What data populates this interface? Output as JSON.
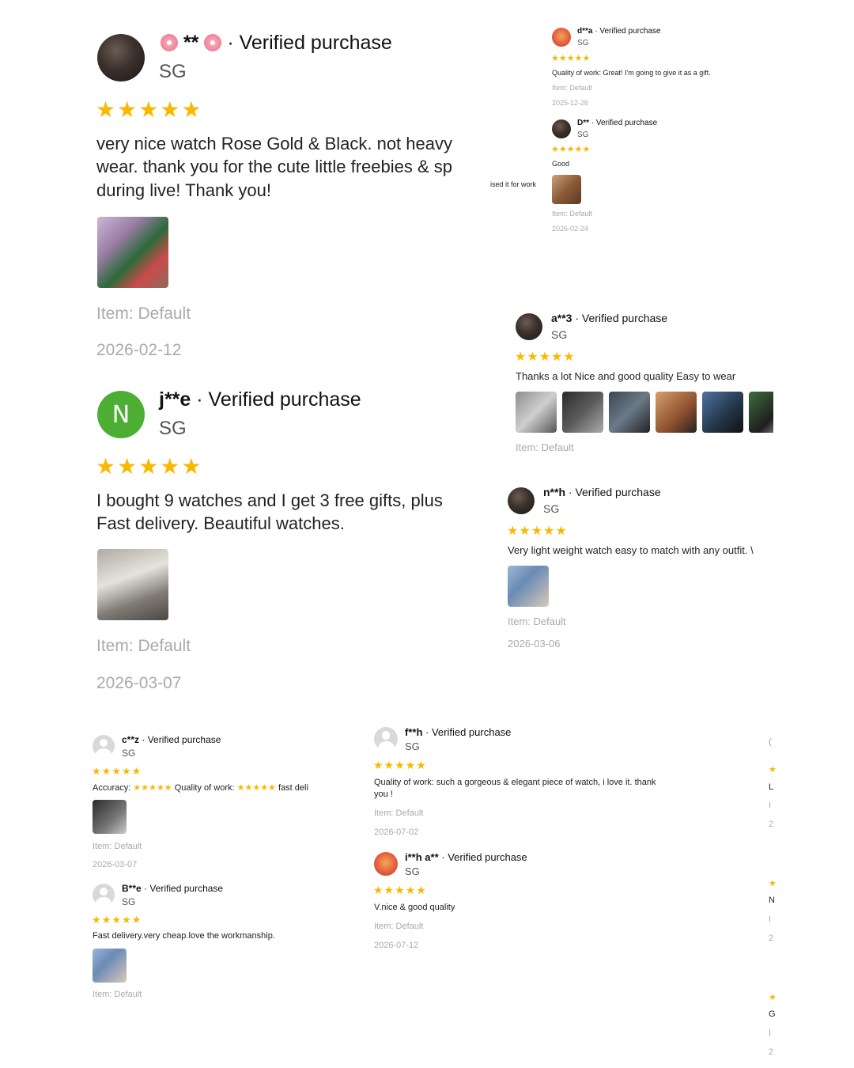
{
  "colors": {
    "star": "#f9b800",
    "meta": "#aaaaaa",
    "green_avatar": "#4caf33"
  },
  "reviews": {
    "r1": {
      "name": "**",
      "sep": "· Verified purchase",
      "country": "SG",
      "stars": "★★★★★",
      "text1": "very nice watch Rose Gold & Black. not heavy",
      "text2": "wear. thank you for the cute little freebies & sp",
      "text3": "during live! Thank you!",
      "item": "Item: Default",
      "date": "2026-02-12"
    },
    "r2": {
      "name": "j**e",
      "sep": "· Verified purchase",
      "country": "SG",
      "avatar_letter": "N",
      "stars": "★★★★★",
      "text1": "I bought 9 watches and I get 3 free gifts, plus",
      "text2": "Fast delivery. Beautiful watches.",
      "item": "Item: Default",
      "date": "2026-03-07"
    },
    "r3": {
      "name": "d**a",
      "sep": "· Verified purchase",
      "country": "SG",
      "stars": "★★★★★",
      "text": "Quality of work: Great! I'm going to give it as a gift.",
      "item": "Item: Default",
      "date": "2025-12-26"
    },
    "r4": {
      "name": "D**",
      "sep": "· Verified purchase",
      "country": "SG",
      "stars": "★★★★★",
      "text": "Good",
      "item": "Item: Default",
      "date": "2026-02-24",
      "side_fragment": "ised it for work"
    },
    "r5": {
      "name": "a**3",
      "sep": "· Verified purchase",
      "country": "SG",
      "stars": "★★★★★",
      "text": "Thanks a lot Nice and good quality Easy to wear",
      "item": "Item: Default"
    },
    "r6": {
      "name": "n**h",
      "sep": "· Verified purchase",
      "country": "SG",
      "stars": "★★★★★",
      "text": "Very light weight watch easy to match with any outfit. \\",
      "item": "Item: Default",
      "date": "2026-03-06"
    },
    "r7": {
      "name": "c**z",
      "sep": "· Verified purchase",
      "country": "SG",
      "stars": "★★★★★",
      "accuracy_label": "Accuracy:",
      "quality_label": "Quality of work:",
      "text_tail": "fast deli",
      "mini_stars": "★★★★★",
      "item": "Item: Default",
      "date": "2026-03-07"
    },
    "r8": {
      "name": "B**e",
      "sep": "· Verified purchase",
      "country": "SG",
      "stars": "★★★★★",
      "text": "Fast delivery.very cheap.love the workmanship.",
      "item": "Item: Default"
    },
    "r9": {
      "name": "f**h",
      "sep": "· Verified purchase",
      "country": "SG",
      "stars": "★★★★★",
      "text1": "Quality of work: such a gorgeous & elegant piece of watch, i love it. thank",
      "text2": "you !",
      "item": "Item: Default",
      "date": "2026-07-02"
    },
    "r10": {
      "name": "i**h a**",
      "sep": "· Verified purchase",
      "country": "SG",
      "stars": "★★★★★",
      "text": "V.nice & good quality",
      "item": "Item: Default",
      "date": "2026-07-12"
    }
  },
  "edge_fragments": {
    "f1": "(",
    "f2": "★",
    "f3": "L",
    "f4": "I",
    "f5": "2",
    "f6": "★",
    "f7": "N",
    "f8": "I",
    "f9": "2",
    "f10": "★",
    "f11": "G",
    "f12": "I",
    "f13": "2"
  }
}
